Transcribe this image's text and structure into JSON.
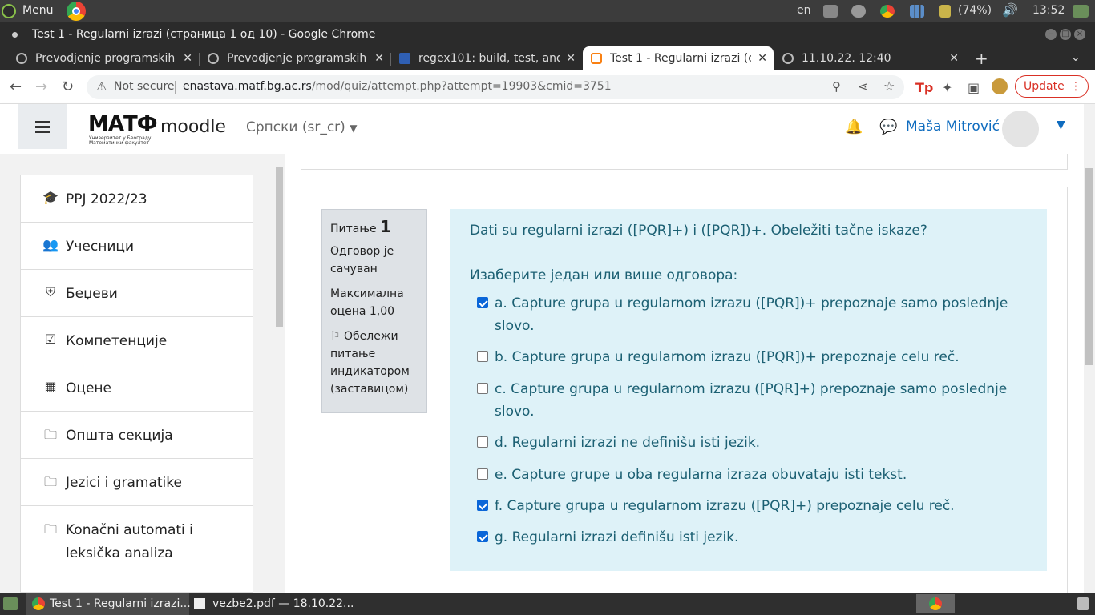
{
  "os_panel": {
    "menu_label": "Menu",
    "keyboard_layout": "en",
    "battery": "(74%)",
    "clock": "13:52"
  },
  "window": {
    "title": "Test 1 - Regularni izrazi (страница 1 од 10) - Google Chrome"
  },
  "tabs": [
    {
      "label": "Prevodjenje programskih",
      "active": false
    },
    {
      "label": "Prevodjenje programskih",
      "active": false
    },
    {
      "label": "regex101: build, test, and",
      "active": false
    },
    {
      "label": "Test 1 - Regularni izrazi (ст",
      "active": true
    },
    {
      "label": "11.10.22. 12:40",
      "active": false
    }
  ],
  "address_bar": {
    "security": "Not secure",
    "url_host": "enastava.matf.bg.ac.rs",
    "url_path": "/mod/quiz/attempt.php?attempt=19903&cmid=3751",
    "update_label": "Update"
  },
  "navbar": {
    "logo_text": "МАТФ",
    "logo_sub": "Универзитет у Београду Математички факултет",
    "brand": "moodle",
    "language": "Српски (sr_cr)",
    "user_name": "Maša Mitrović"
  },
  "drawer": {
    "items": [
      {
        "label": "PPJ 2022/23",
        "icon": "graduation-cap-icon"
      },
      {
        "label": "Учесници",
        "icon": "users-icon"
      },
      {
        "label": "Беџеви",
        "icon": "shield-icon"
      },
      {
        "label": "Компетенције",
        "icon": "checkbox-icon"
      },
      {
        "label": "Оцене",
        "icon": "table-icon"
      },
      {
        "label": "Општа секција",
        "icon": "folder-icon"
      },
      {
        "label": "Jezici i gramatike",
        "icon": "folder-icon"
      },
      {
        "label": "Konačni automati i leksička analiza",
        "icon": "folder-icon"
      }
    ]
  },
  "question": {
    "label": "Питање",
    "number": "1",
    "status": "Одговор је сачуван",
    "max_grade": "Максимална оцена 1,00",
    "flag_label": "Обележи питање индикатором (заставицом)",
    "text": "Dati su regularni izrazi ([PQR]+) i ([PQR])+. Obeležiti tačne iskaze?",
    "prompt": "Изаберите један или више одговора:",
    "options": [
      {
        "text": "a. Capture grupa u regularnom izrazu ([PQR])+ prepoznaje samo poslednje slovo.",
        "checked": true
      },
      {
        "text": "b. Capture grupa u regularnom izrazu ([PQR])+ prepoznaje celu reč.",
        "checked": false
      },
      {
        "text": "c. Capture grupa u regularnom izrazu ([PQR]+) prepoznaje samo poslednje slovo.",
        "checked": false
      },
      {
        "text": "d. Regularni izrazi ne definišu isti jezik.",
        "checked": false
      },
      {
        "text": "e. Capture grupe u oba regularna izraza obuvataju isti tekst.",
        "checked": false
      },
      {
        "text": "f. Capture grupa u regularnom izrazu ([PQR]+) prepoznaje celu reč.",
        "checked": true
      },
      {
        "text": "g. Regularni izrazi definišu isti jezik.",
        "checked": true
      }
    ]
  },
  "taskbar": {
    "items": [
      {
        "label": "Test 1 - Regularni izrazi..."
      },
      {
        "label": "vezbe2.pdf — 18.10.22..."
      }
    ]
  }
}
